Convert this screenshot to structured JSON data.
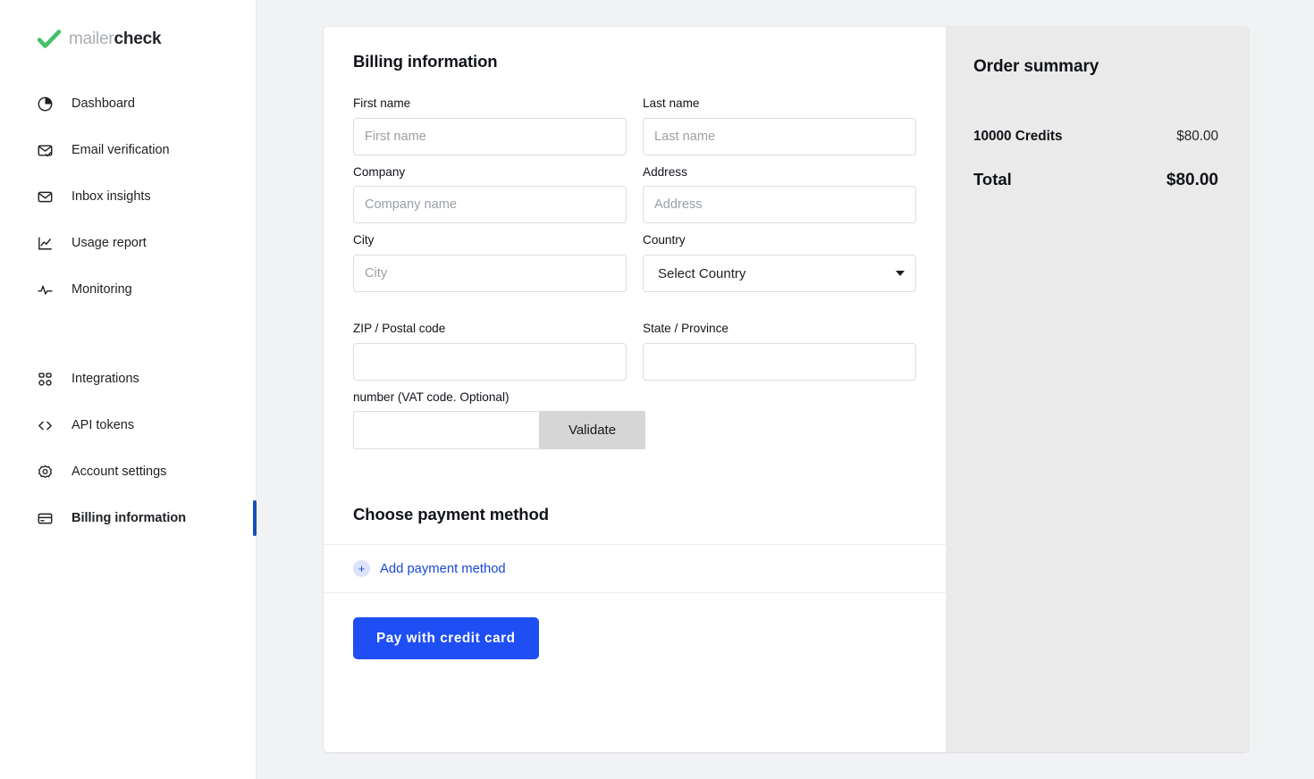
{
  "brand": {
    "name_light": "mailer",
    "name_bold": "check",
    "check_color": "#45c16a"
  },
  "sidebar": {
    "groups": [
      {
        "items": [
          {
            "label": "Dashboard",
            "icon": "pie-chart-icon",
            "active": false
          },
          {
            "label": "Email verification",
            "icon": "envelope-check-icon",
            "active": false
          },
          {
            "label": "Inbox insights",
            "icon": "inbox-icon",
            "active": false
          },
          {
            "label": "Usage report",
            "icon": "line-chart-icon",
            "active": false
          },
          {
            "label": "Monitoring",
            "icon": "activity-pulse-icon",
            "active": false
          }
        ]
      },
      {
        "items": [
          {
            "label": "Integrations",
            "icon": "grid-apps-icon",
            "active": false
          },
          {
            "label": "API tokens",
            "icon": "code-brackets-icon",
            "active": false
          },
          {
            "label": "Account settings",
            "icon": "gear-icon",
            "active": false
          },
          {
            "label": "Billing information",
            "icon": "credit-card-icon",
            "active": true
          }
        ]
      }
    ],
    "active_indicator_color": "#1a4fb4"
  },
  "billing": {
    "title": "Billing information",
    "fields": {
      "first_name": {
        "label": "First name",
        "placeholder": "First name",
        "value": ""
      },
      "last_name": {
        "label": "Last name",
        "placeholder": "Last name",
        "value": ""
      },
      "company": {
        "label": "Company",
        "placeholder": "Company name",
        "value": ""
      },
      "address": {
        "label": "Address",
        "placeholder": "Address",
        "value": ""
      },
      "city": {
        "label": "City",
        "placeholder": "City",
        "value": ""
      },
      "country": {
        "label": "Country",
        "selected": "Select Country"
      },
      "zip": {
        "label": "ZIP / Postal code",
        "placeholder": "",
        "value": ""
      },
      "state": {
        "label": "State / Province",
        "placeholder": "",
        "value": ""
      },
      "vat": {
        "label": "number (VAT code. Optional)",
        "placeholder": "",
        "value": "",
        "button": "Validate"
      }
    }
  },
  "payment": {
    "title": "Choose payment method",
    "add_label": "Add payment method",
    "add_icon": "plus-icon",
    "pay_button": "Pay with credit card",
    "accent_color": "#1f4ef5"
  },
  "order_summary": {
    "title": "Order summary",
    "lines": [
      {
        "label": "10000 Credits",
        "value": "$80.00"
      }
    ],
    "total": {
      "label": "Total",
      "value": "$80.00"
    }
  }
}
